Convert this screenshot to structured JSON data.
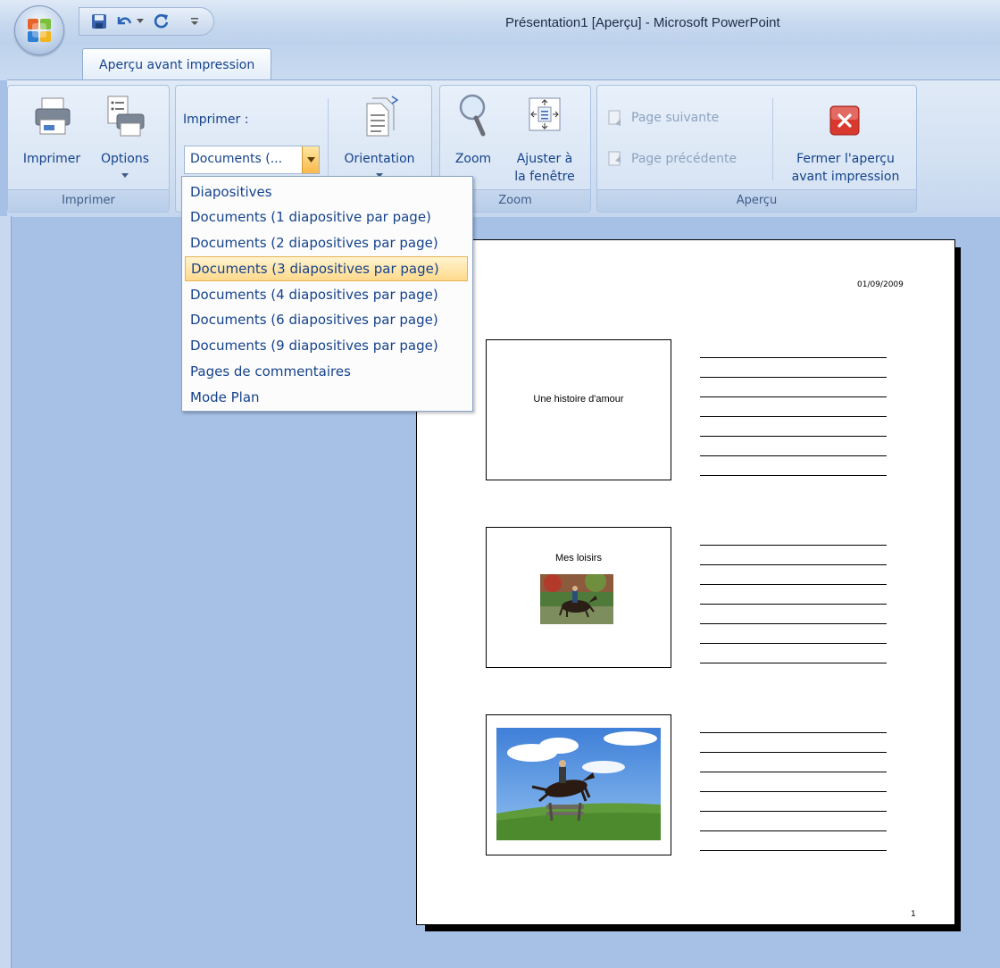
{
  "window": {
    "title": "Présentation1 [Aperçu] - Microsoft PowerPoint"
  },
  "quick_access": [
    "save-icon",
    "undo-icon",
    "dropdown-icon",
    "redo-icon",
    "customize-icon"
  ],
  "tabs": {
    "active": "Aperçu avant impression"
  },
  "ribbon": {
    "groups": {
      "imprimer": {
        "label": "Imprimer",
        "print_button": "Imprimer",
        "options_button": "Options"
      },
      "mise_en_page": {
        "print_what_label": "Imprimer :",
        "print_what_value": "Documents (...",
        "orientation_button": "Orientation"
      },
      "zoom": {
        "label": "Zoom",
        "zoom_button": "Zoom",
        "fit_line1": "Ajuster à",
        "fit_line2": "la fenêtre"
      },
      "apercu": {
        "label": "Aperçu",
        "next_page": "Page suivante",
        "prev_page": "Page précédente",
        "close_line1": "Fermer l'aperçu",
        "close_line2": "avant impression"
      }
    }
  },
  "dropdown": {
    "items": [
      "Diapositives",
      "Documents (1 diapositive par page)",
      "Documents (2 diapositives par page)",
      "Documents (3 diapositives par page)",
      "Documents (4 diapositives par page)",
      "Documents (6 diapositives par page)",
      "Documents (9 diapositives par page)",
      "Pages de commentaires",
      "Mode Plan"
    ],
    "selected": "Documents (3 diapositives par page)"
  },
  "preview": {
    "date": "01/09/2009",
    "page_number": "1",
    "slides": [
      {
        "title": "Une histoire d'amour"
      },
      {
        "title": "Mes loisirs",
        "image": "horse-rider-field-photo"
      },
      {
        "title": "",
        "image": "horse-jumping-fence-photo"
      }
    ]
  },
  "colors": {
    "accent_text": "#15428b",
    "workspace": "#a6c0e6",
    "selection": "#ffd98c",
    "close_red": "#d9382e"
  }
}
